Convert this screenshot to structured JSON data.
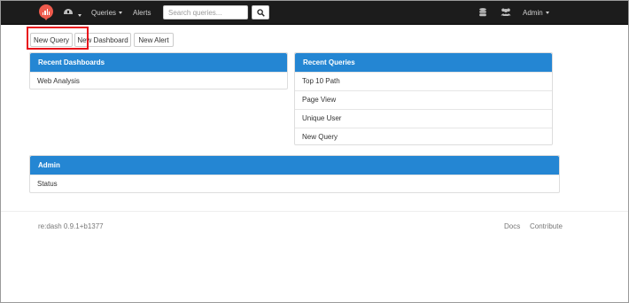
{
  "navbar": {
    "queries_label": "Queries",
    "alerts_label": "Alerts",
    "search_placeholder": "Search queries...",
    "user_label": "Admin"
  },
  "actions": {
    "new_query": "New Query",
    "new_dashboard": "New Dashboard",
    "new_alert": "New Alert"
  },
  "recent_dashboards": {
    "title": "Recent Dashboards",
    "items": [
      "Web Analysis"
    ]
  },
  "recent_queries": {
    "title": "Recent Queries",
    "items": [
      "Top 10 Path",
      "Page View",
      "Unique User",
      "New Query"
    ]
  },
  "admin": {
    "title": "Admin",
    "items": [
      "Status"
    ]
  },
  "footer": {
    "version": "re:dash 0.9.1+b1377",
    "docs": "Docs",
    "contribute": "Contribute"
  },
  "colors": {
    "navbar": "#1c1c1c",
    "panel_heading": "#2486d3",
    "logo": "#ef5b4d",
    "highlight": "#e8141b"
  },
  "icons": [
    "redash-logo-icon",
    "dashboards-icon",
    "search-icon",
    "database-icon",
    "users-icon"
  ]
}
